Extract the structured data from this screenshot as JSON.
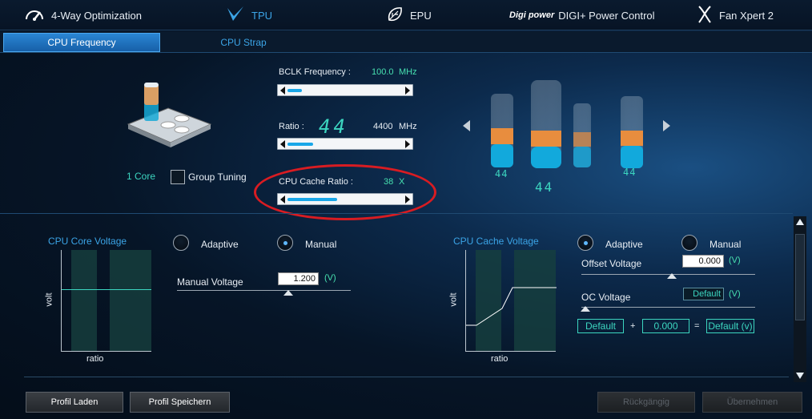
{
  "nav": {
    "items": [
      {
        "label": "4-Way Optimization",
        "icon": "speedometer-icon"
      },
      {
        "label": "TPU",
        "icon": "tpu-check-icon"
      },
      {
        "label": "EPU",
        "icon": "leaf-icon"
      },
      {
        "label": "DIGI+ Power Control",
        "icon": "digi-logo-icon",
        "logo_text": "Digi power"
      },
      {
        "label": "Fan Xpert 2",
        "icon": "fan-icon"
      }
    ]
  },
  "subtabs": [
    {
      "label": "CPU Frequency",
      "active": true
    },
    {
      "label": "CPU Strap",
      "active": false
    }
  ],
  "freq": {
    "bclk_label": "BCLK Frequency :",
    "bclk_value": "100.0",
    "bclk_unit": "MHz",
    "ratio_label": "Ratio :",
    "ratio_big": "44",
    "ratio_freq": "4400",
    "ratio_unit": "MHz",
    "cache_label": "CPU Cache Ratio :",
    "cache_value": "38",
    "cache_unit": "X",
    "core_label": "1 Core",
    "group_tuning_label": "Group Tuning"
  },
  "cores": {
    "values": [
      "44",
      "44",
      "44"
    ]
  },
  "core_voltage": {
    "title": "CPU Core Voltage",
    "adaptive_label": "Adaptive",
    "manual_label": "Manual",
    "selected": "Manual",
    "manual_voltage_label": "Manual Voltage",
    "manual_voltage_value": "1.200",
    "unit": "(V)",
    "y_axis": "volt",
    "x_axis": "ratio"
  },
  "cache_voltage": {
    "title": "CPU Cache Voltage",
    "adaptive_label": "Adaptive",
    "manual_label": "Manual",
    "selected": "Adaptive",
    "offset_label": "Offset Voltage",
    "offset_value": "0.000",
    "oc_label": "OC Voltage",
    "oc_value": "Default",
    "unit": "(V)",
    "formula_a": "Default",
    "formula_plus": "+",
    "formula_b": "0.000",
    "formula_eq": "=",
    "formula_result": "Default (v)",
    "y_axis": "volt",
    "x_axis": "ratio"
  },
  "footer": {
    "load_profile": "Profil Laden",
    "save_profile": "Profil Speichern",
    "undo": "Rückgängig",
    "apply": "Übernehmen"
  },
  "colors": {
    "accent": "#3cd6c0",
    "tab_active": "#1f74c4",
    "annotation": "#d81c22"
  }
}
